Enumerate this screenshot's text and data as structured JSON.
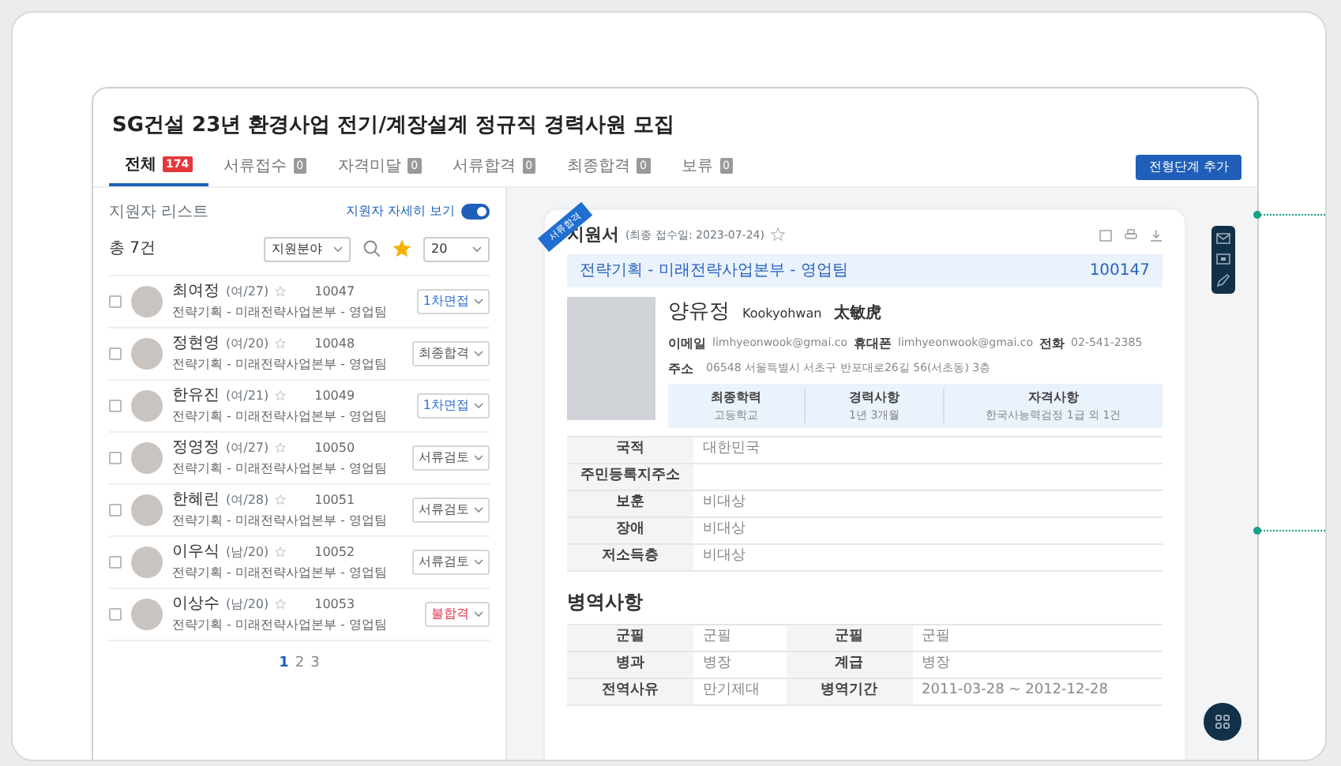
{
  "page_title": "SG건설 23년 환경사업 전기/계장설계 정규직 경력사원 모집",
  "tabs": [
    {
      "label": "전체",
      "count": "174",
      "selected": true,
      "kind": "new"
    },
    {
      "label": "서류접수",
      "count": "0",
      "selected": false,
      "kind": "plain"
    },
    {
      "label": "자격미달",
      "count": "0",
      "selected": false,
      "kind": "plain"
    },
    {
      "label": "서류합격",
      "count": "0",
      "selected": false,
      "kind": "plain"
    },
    {
      "label": "최종합격",
      "count": "0",
      "selected": false,
      "kind": "plain"
    },
    {
      "label": "보류",
      "count": "0",
      "selected": false,
      "kind": "plain"
    }
  ],
  "add_button": "전형단계 추가",
  "list_panel": {
    "title": "지원자 리스트",
    "toggle": {
      "label": "지원자 자세히 보기",
      "on": true
    },
    "total": "총 7건",
    "field_select": "지원분야",
    "page_size": "20",
    "applicants": [
      {
        "name": "최여정",
        "info": "(여/27)",
        "number": "10047",
        "dept": "전략기획 - 미래전략사업본부 - 영업팀",
        "checked": false,
        "status": {
          "label": "1차면접",
          "color": "#2f6fd6"
        }
      },
      {
        "name": "정현영",
        "info": "(여/20)",
        "number": "10048",
        "dept": "전략기획 - 미래전략사업본부 - 영업팀",
        "checked": false,
        "status": {
          "label": "최종합격",
          "color": "#555555"
        }
      },
      {
        "name": "한유진",
        "info": "(여/21)",
        "number": "10049",
        "dept": "전략기획 - 미래전략사업본부 - 영업팀",
        "checked": false,
        "status": {
          "label": "1차면접",
          "color": "#2f6fd6"
        }
      },
      {
        "name": "정영정",
        "info": "(여/27)",
        "number": "10050",
        "dept": "전략기획 - 미래전략사업본부 - 영업팀",
        "checked": false,
        "status": {
          "label": "서류검토",
          "color": "#555555"
        }
      },
      {
        "name": "한혜린",
        "info": "(여/28)",
        "number": "10051",
        "dept": "전략기획 - 미래전략사업본부 - 영업팀",
        "checked": false,
        "status": {
          "label": "서류검토",
          "color": "#555555"
        }
      },
      {
        "name": "이우식",
        "info": "(남/20)",
        "number": "10052",
        "dept": "전략기획 - 미래전략사업본부 - 영업팀",
        "checked": false,
        "status": {
          "label": "서류검토",
          "color": "#555555"
        }
      },
      {
        "name": "이상수",
        "info": "(남/20)",
        "number": "10053",
        "dept": "전략기획 - 미래전략사업본부 - 영업팀",
        "checked": false,
        "status": {
          "label": "불합격",
          "color": "#e0334a"
        }
      }
    ],
    "pages": [
      {
        "label": "1",
        "selected": true
      },
      {
        "label": "2",
        "selected": false
      },
      {
        "label": "3",
        "selected": false
      }
    ]
  },
  "application": {
    "ribbon": "서류합격",
    "title": "지원서",
    "date": "(최종 접수일: 2023-07-24)",
    "dept": "전략기획 - 미래전략사업본부 - 영업팀",
    "number": "100147",
    "name": "양유정",
    "name_en": "Kookyohwan",
    "name_cn": "太敏虎",
    "contacts": [
      {
        "label": "이메일",
        "value": "limhyeonwook@gmai.co"
      },
      {
        "label": "휴대폰",
        "value": "limhyeonwook@gmai.co"
      },
      {
        "label": "전화",
        "value": "02-541-2385"
      }
    ],
    "address": {
      "label": "주소",
      "value": "06548 서울특별시 서초구 반포대로26길 56(서초동) 3층"
    },
    "summary": [
      {
        "label": "최종학력",
        "value": "고등학교"
      },
      {
        "label": "경력사항",
        "value": "1년 3개월"
      },
      {
        "label": "자격사항",
        "value": "한국사능력검정 1급 외 1건"
      }
    ],
    "details": [
      {
        "label": "국적",
        "value": "대한민국"
      },
      {
        "label": "주민등록지주소"
      },
      {
        "label": "보훈",
        "value": "비대상"
      },
      {
        "label": "장애",
        "value": "비대상"
      },
      {
        "label": "저소득층",
        "value": "비대상"
      }
    ],
    "military_title": "병역사항",
    "military": [
      [
        {
          "label": "군필",
          "value": "군필"
        },
        {
          "label": "군필",
          "value": "군필"
        }
      ],
      [
        {
          "label": "병과",
          "value": "병장"
        },
        {
          "label": "계급",
          "value": "병장"
        }
      ],
      [
        {
          "label": "전역사유",
          "value": "만기제대"
        },
        {
          "label": "병역기간",
          "value": "2011-03-28 ~ 2012-12-28"
        }
      ]
    ]
  }
}
